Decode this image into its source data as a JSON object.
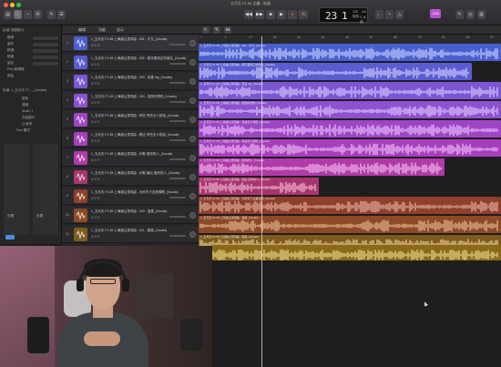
{
  "window": {
    "title": "五月天 F1 58 主编 - 轨道",
    "close_color": "#ff5f57",
    "minimize_color": "#febc2e",
    "maximize_color": "#28c840"
  },
  "transport": {
    "rewind_icon": "rewind-icon",
    "forward_icon": "fast-forward-icon",
    "stop_icon": "stop-icon",
    "play_icon": "play-icon",
    "record_icon": "record-icon",
    "cycle_icon": "cycle-icon",
    "record_color": "#e34b3b",
    "cycle_color": "#e6b430",
    "bar": "23",
    "beat": "1",
    "tempo": "120",
    "tempo_label": "保持",
    "signature": "4/4",
    "key": "C 大调"
  },
  "toolbar_right": {
    "badge": "1234",
    "badge_color": "#b653d2"
  },
  "inspector": {
    "title": "区域: 视频影片",
    "rows": [
      "静音",
      "循环",
      "移调",
      "精细",
      "量化",
      "Flex 和跟随",
      "增益"
    ],
    "track_label": "轨道: 1_五月天 F1 ..._(Vocals)",
    "track_rows": [
      "图标",
      "通道",
      "Audio 1",
      "冻结模式",
      "Q-参考",
      "Flex 模式"
    ],
    "bottom_left": "设置",
    "bottom_right": "设置"
  },
  "tracks_header": {
    "edit": "编辑",
    "functions": "功能",
    "view": "显示"
  },
  "tracks": [
    {
      "num": "1",
      "name": "1_五月天 F1 58 上海滩山顶词曲 - 001 - 平凡_(Vocals)",
      "color": "#4a5fcf",
      "btns": "M  S  R"
    },
    {
      "num": "2",
      "name": "1_五月天 F1 58 上海滩山顶词曲 - 002 - 那天要真正的朋友_(Vocals)",
      "color": "#5a5cd2",
      "btns": "M  S  R"
    },
    {
      "num": "3",
      "name": "1_五月天 F1 58 上海滩山顶词曲 - 003 - 恋爱 ing_(Vocals)",
      "color": "#7a56d3",
      "btns": "M  S  R"
    },
    {
      "num": "4",
      "name": "1_五月天 F1 58 上海滩山顶词曲 - 004 - 突然好想你_(Vocals)",
      "color": "#8d52cf",
      "btns": "M  S  R"
    },
    {
      "num": "5",
      "name": "1_五月天 F1 58 上海滩山顶词曲 - 有些 有些无人知晓_(Vocals)",
      "color": "#9e45c4",
      "btns": "M  S  R"
    },
    {
      "num": "6",
      "name": "1_五月天 F1 58 上海滩山顶词曲 - 眼过 有些无人知晓_(Vocals)",
      "color": "#a63fbe",
      "btns": "M  S  R"
    },
    {
      "num": "7",
      "name": "1_五月天 F1 58 上海滩山顶词曲 - 步鞋 爱你的人_(Vocals)",
      "color": "#b03aa8",
      "btns": "M  S  R"
    },
    {
      "num": "8",
      "name": "1_五月天 F1 58 上海滩山顶词曲 - 步鞋 最后 爱你的人_(Vocals)",
      "color": "#a9356e",
      "btns": "M  S  R"
    },
    {
      "num": "9",
      "name": "1_五月天 F1 58 上海滩山顶词曲 - 为你写下这首情歌_(Vocals)",
      "color": "#8f3f2c",
      "btns": "M  S  R"
    },
    {
      "num": "10",
      "name": "1_五月天 F1 58 上海滩山顶词曲 - 010 - 温柔_(Vocals)",
      "color": "#8e4a26",
      "btns": "M  S  R"
    },
    {
      "num": "11",
      "name": "1_五月天 F1 58 上海滩山顶词曲 - 011 - 倔强_(Vocals)",
      "color": "#7d5a1e",
      "btns": "M  S  R"
    }
  ],
  "ruler": {
    "labels": [
      "1",
      "9",
      "17",
      "25",
      "33",
      "41",
      "49",
      "57",
      "65",
      "73",
      "81",
      "89",
      "97"
    ]
  },
  "regions": [
    {
      "name": "1_五月天 F1 58 上海滩山顶词曲 - 001 - 平凡_(Vocals)",
      "color": "#4a5fcf",
      "wave": "#c9d1ff"
    },
    {
      "name": "1_五月天 F1 58 上海滩山顶词曲 - 那天要真正的朋友_(Vocals)",
      "color": "#5a5cd2",
      "wave": "#d0d0ff"
    },
    {
      "name": "1_五月天 F1 58 上海滩山顶词曲 - 恋爱 ing_(Vocals)",
      "color": "#7a56d3",
      "wave": "#dccbff"
    },
    {
      "name": "1_五月天 F1 58 上海滩山顶词曲 - 突然好想你_(Vocals)",
      "color": "#8d52cf",
      "wave": "#e2c8ff"
    },
    {
      "name": "1_五月天 F1 58 上海滩山顶词曲 - 有些无人知晓_(Vocals)",
      "color": "#9e45c4",
      "wave": "#ecc2ff"
    },
    {
      "name": "1_五月天 F1 58 上海滩山顶词曲 - 有些无人知晓_(Vocals)",
      "color": "#a63fbe",
      "wave": "#f2c0f5"
    },
    {
      "name": "1_五月天 F1 58 上海滩山顶词曲 - 爱你的人_(Vocals)",
      "color": "#b03aa8",
      "wave": "#f6bdf0"
    },
    {
      "name": "1_五月天 F1 58 上海滩山顶词曲 - 最后 爱你的人_(Vocals)",
      "color": "#a9356e",
      "wave": "#f5bcd6"
    },
    {
      "name": "1_五月天 F1 58 上海滩山顶词曲 - 为你写下这首情歌_(Vocals)",
      "color": "#8f3f2c",
      "wave": "#e6b39f"
    },
    {
      "name": "1_五月天 F1 58 上海滩山顶词曲 - 温柔_(Vocals)",
      "color": "#8e4a26",
      "wave": "#e6bc98"
    },
    {
      "name": "1_五月天 F1 58 上海滩山顶词曲 - 倔强_(Vocals)",
      "color": "#7d5a1e",
      "wave": "#e8cf96"
    },
    {
      "name": "1_五月天 F1 58 上海滩山顶词曲 - 倔强_(Vocals)",
      "color": "#8a6a18",
      "wave": "#ecd890"
    }
  ],
  "webcam": {
    "description_icon": "webcam-person-icon"
  }
}
